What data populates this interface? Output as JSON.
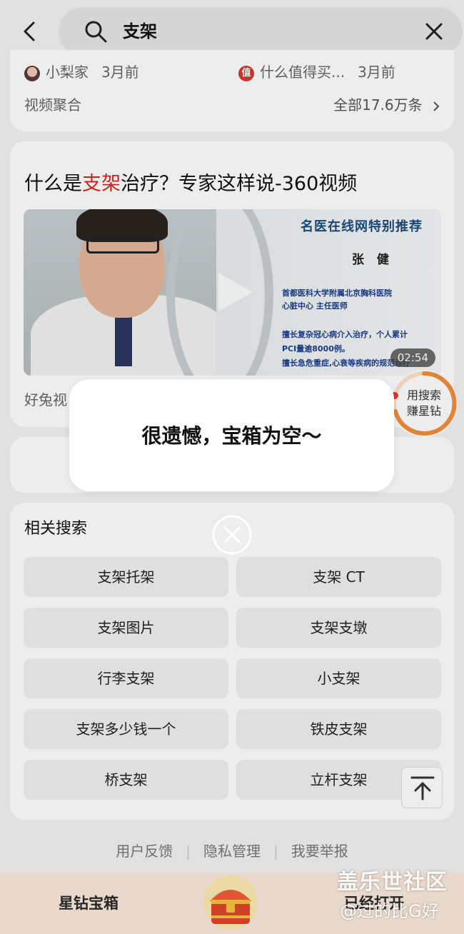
{
  "search": {
    "query": "支架"
  },
  "top_card": {
    "sources": [
      {
        "name": "小梨家",
        "time": "3月前"
      },
      {
        "name": "什么值得买...",
        "time": "3月前",
        "logo_text": "值"
      }
    ],
    "aggregate_label": "视频聚合",
    "aggregate_all": "全部17.6万条"
  },
  "video": {
    "title_pre": "什么是",
    "title_highlight": "支架",
    "title_post": "治疗？专家这样说-360视频",
    "thumb_heading": "名医在线网特别推荐",
    "thumb_name": "张 健",
    "thumb_lines": [
      "首都医科大学附属北京胸科医院",
      "心脏中心  主任医师",
      "擅长复杂冠心病介入治疗，个人累计",
      "PCI量逾8000例。",
      "擅长急危重症,心衰等疾病的规范诊疗"
    ],
    "duration": "02:54",
    "source": "好兔视"
  },
  "badge": {
    "line1": "用搜索",
    "line2": "赚星钻"
  },
  "related": {
    "title": "相关搜索",
    "items": [
      "支架托架",
      "支架 CT",
      "支架图片",
      "支架支墩",
      "行李支架",
      "小支架",
      "支架多少钱一个",
      "铁皮支架",
      "桥支架",
      "立杆支架"
    ]
  },
  "footer": {
    "links": [
      "用户反馈",
      "隐私管理",
      "我要举报"
    ]
  },
  "bottom_bar": {
    "left": "星钻宝箱",
    "right": "已经打开"
  },
  "dialog": {
    "message": "很遗憾，宝箱为空～"
  },
  "watermark": {
    "line1": "盖乐世社区",
    "line2": "@过的比G好"
  },
  "colors": {
    "highlight": "#d5281f",
    "badge_ring": "#f0903a",
    "bottom_bar": "#fbeadc"
  }
}
